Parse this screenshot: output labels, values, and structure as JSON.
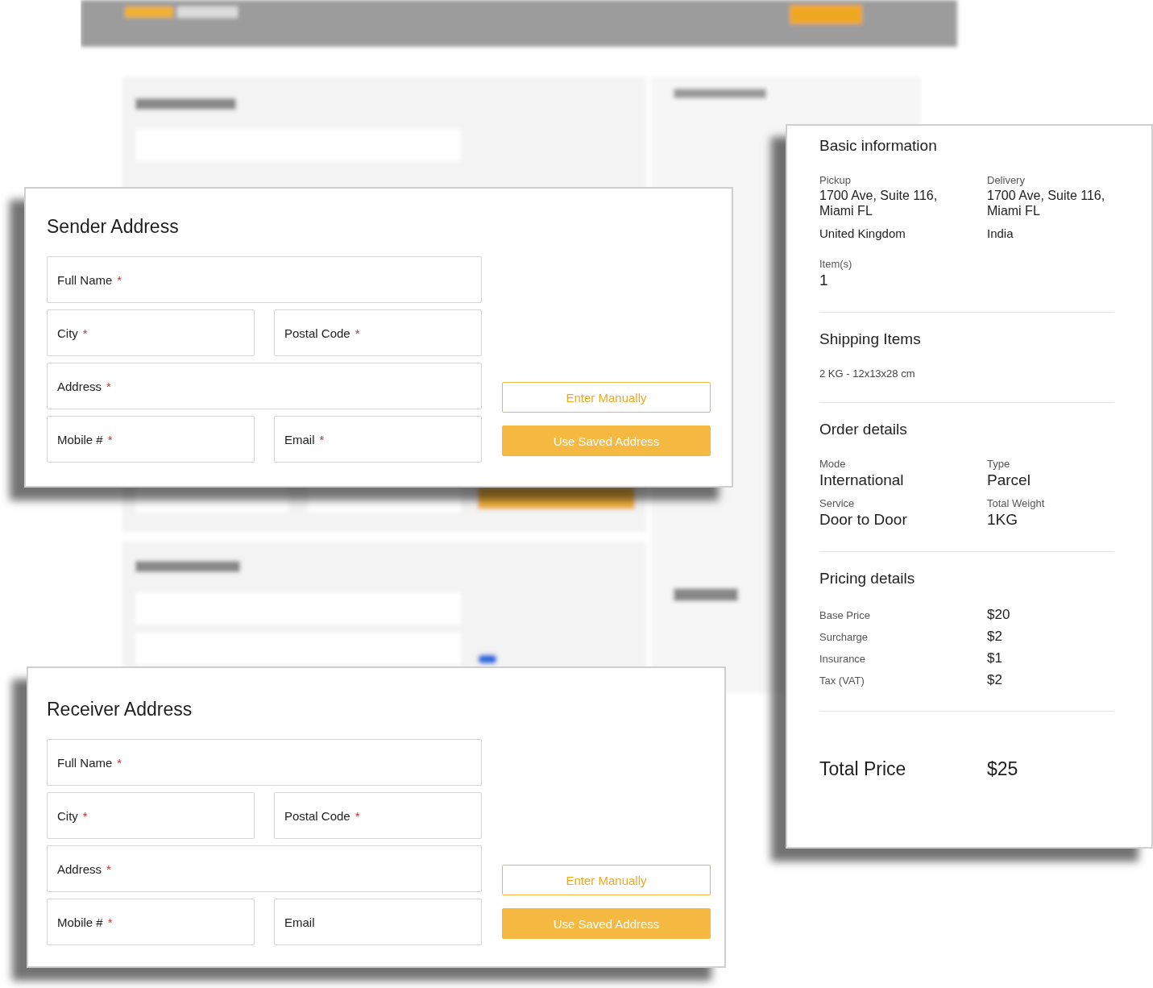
{
  "sender": {
    "title": "Sender Address",
    "rows": [
      [
        {
          "label": "Full Name",
          "mark": "*"
        }
      ],
      [
        {
          "label": "City",
          "mark": "*"
        },
        {
          "label": "Postal Code",
          "mark": "*"
        }
      ],
      [
        {
          "label": "Address",
          "mark": "*"
        }
      ],
      [
        {
          "label": "Mobile #",
          "mark": "*"
        },
        {
          "label": "Email",
          "mark": "*"
        }
      ]
    ],
    "buttons": [
      {
        "label": "Enter Manually",
        "kind": "outline"
      },
      {
        "label": "Use Saved Address",
        "kind": "filled"
      }
    ]
  },
  "receiver": {
    "title": "Receiver Address",
    "rows": [
      [
        {
          "label": "Full Name",
          "mark": "*"
        }
      ],
      [
        {
          "label": "City",
          "mark": "*"
        },
        {
          "label": "Postal Code",
          "mark": "*"
        }
      ],
      [
        {
          "label": "Address",
          "mark": "*"
        }
      ],
      [
        {
          "label": "Mobile #",
          "mark": "*"
        },
        {
          "label": "Email"
        }
      ]
    ],
    "buttons": [
      {
        "label": "Enter Manually",
        "kind": "outline"
      },
      {
        "label": "Use Saved Address",
        "kind": "filled"
      }
    ]
  },
  "summary": {
    "sections": [
      {
        "kind": "addresses",
        "title": "Basic information",
        "columns": [
          {
            "label": "Pickup",
            "lines": [
              "1700 Ave, Suite 116,",
              "Miami FL"
            ],
            "country": "United Kingdom"
          },
          {
            "label": "Delivery",
            "lines": [
              "1700 Ave, Suite 116,",
              "Miami FL"
            ],
            "country": "India"
          }
        ],
        "count": {
          "label": "Item(s)",
          "value": "1"
        }
      },
      {
        "kind": "list",
        "title": "Shipping Items",
        "items": [
          "2 KG - 12x13x28 cm"
        ]
      },
      {
        "kind": "pairs",
        "title": "Order details",
        "pairs": [
          {
            "label": "Mode",
            "value": "International"
          },
          {
            "label": "Type",
            "value": "Parcel"
          },
          {
            "label": "Service",
            "value": "Door to Door"
          },
          {
            "label": "Total Weight",
            "value": "1KG"
          }
        ]
      },
      {
        "kind": "prices",
        "title": "Pricing details",
        "rows": [
          {
            "label": "Base Price",
            "value": "$20"
          },
          {
            "label": "Surcharge",
            "value": "$2"
          },
          {
            "label": "Insurance",
            "value": "$1"
          },
          {
            "label": "Tax (VAT)",
            "value": "$2"
          }
        ]
      },
      {
        "kind": "total",
        "label": "Total Price",
        "value": "$25"
      }
    ]
  }
}
